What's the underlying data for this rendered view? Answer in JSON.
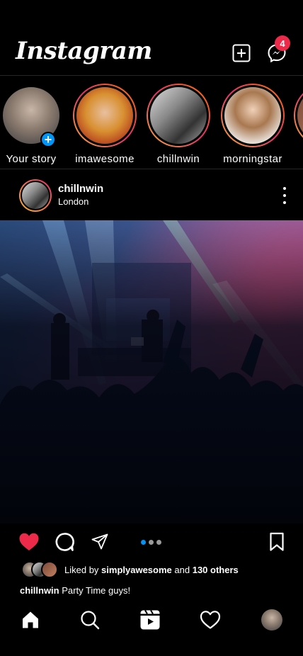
{
  "header": {
    "logo": "Instagram",
    "messages_badge": "4"
  },
  "stories": [
    {
      "label": "Your story",
      "own": true
    },
    {
      "label": "imawesome"
    },
    {
      "label": "chillnwin"
    },
    {
      "label": "morningstar"
    }
  ],
  "post": {
    "username": "chillnwin",
    "location": "London",
    "liked_by_prefix": "Liked by",
    "liked_by_user": "simplyawesome",
    "liked_by_and": "and",
    "liked_by_others": "130 others",
    "caption_user": "chillnwin",
    "caption_text": "Party Time guys!"
  },
  "colors": {
    "accent": "#0095f6",
    "like": "#ed2a4a",
    "badge": "#ed2a4a"
  },
  "icons": {
    "new_post": "plus-square-icon",
    "messenger": "messenger-icon",
    "like": "heart-filled-icon",
    "comment": "comment-icon",
    "share": "paper-plane-icon",
    "save": "bookmark-icon",
    "home": "home-icon",
    "search": "search-icon",
    "reels": "reels-icon",
    "activity": "heart-icon"
  }
}
